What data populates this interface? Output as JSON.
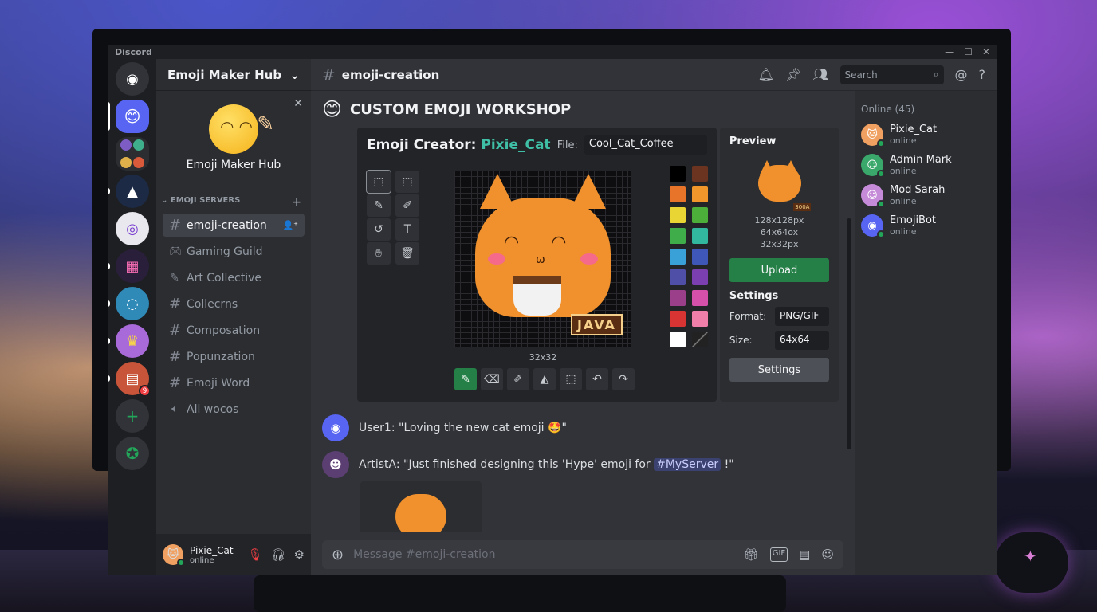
{
  "window": {
    "title": "Discord",
    "controls": [
      "—",
      "☐",
      "✕"
    ]
  },
  "server_rail": {
    "items": [
      {
        "name": "home",
        "icon": "discord-logo"
      },
      {
        "name": "emoji-maker-hub",
        "icon": "pencil-smiley",
        "active": true
      },
      {
        "name": "server-group"
      },
      {
        "name": "server-mountain"
      },
      {
        "name": "server-eye"
      },
      {
        "name": "server-pixel"
      },
      {
        "name": "server-ring"
      },
      {
        "name": "server-yellow"
      },
      {
        "name": "server-collage",
        "badge": "9"
      }
    ],
    "add_label": "+",
    "explore_icon": "compass-icon"
  },
  "sidebar": {
    "server_name": "Emoji Maker Hub",
    "banner_title": "Emoji Maker Hub",
    "category": "EMOJI SERVERS",
    "channels": [
      {
        "name": "emoji-creation",
        "icon": "#",
        "selected": true
      },
      {
        "name": "Gaming Guild",
        "icon": "gamepad"
      },
      {
        "name": "Art Collective",
        "icon": "pencil"
      },
      {
        "name": "Collecrns",
        "icon": "#"
      },
      {
        "name": "Composation",
        "icon": "#"
      },
      {
        "name": "Popunzation",
        "icon": "#"
      },
      {
        "name": "Emoji Word",
        "icon": "#"
      },
      {
        "name": "All wocos",
        "icon": "speaker"
      }
    ]
  },
  "user_bar": {
    "name": "Pixie_Cat",
    "status": "online"
  },
  "topbar": {
    "channel": "emoji-creation",
    "search_placeholder": "Search"
  },
  "workshop": {
    "title": "CUSTOM EMOJI WORKSHOP",
    "creator_label": "Emoji Creator:",
    "creator_user": "Pixie_Cat",
    "file_label": "File:",
    "file_value": "Cool_Cat_Coffee",
    "canvas_text": "JAVA",
    "canvas_size": "32x32",
    "palette": [
      "#000000",
      "#6b3420",
      "#e8742a",
      "#f0962a",
      "#e9d634",
      "#4caf3a",
      "#3fae4a",
      "#33b8a0",
      "#3aa0d8",
      "#3f57b8",
      "#4f4fa8",
      "#7b3fb0",
      "#9c3f8a",
      "#d64fa8",
      "#d83434",
      "#ef7ea8",
      "#ffffff",
      "#222222"
    ],
    "preview": {
      "title": "Preview",
      "tag": "300A",
      "sizes": [
        "128x128px",
        "64x64ox",
        "32x32px"
      ],
      "upload": "Upload"
    },
    "settings": {
      "title": "Settings",
      "format_label": "Format:",
      "format_value": "PNG/GIF",
      "size_label": "Size:",
      "size_value": "64x64",
      "button": "Settings"
    }
  },
  "messages": [
    {
      "author": "User1:",
      "text": "\"Loving the new cat emoji ",
      "emoji": "🤩",
      "tail": "\""
    },
    {
      "author": "ArtistA:",
      "text": "\"Just finished designing this 'Hype' emoji for ",
      "mention": "#MyServer",
      "tail": " !\""
    }
  ],
  "composer": {
    "placeholder": "Message #emoji-creation",
    "gif": "GIF"
  },
  "members": {
    "heading": "Online (45)",
    "list": [
      {
        "name": "Pixie_Cat",
        "status": "online",
        "color": "#f0a060"
      },
      {
        "name": "Admin Mark",
        "status": "online",
        "color": "#3aa86a"
      },
      {
        "name": "Mod Sarah",
        "status": "online",
        "color": "#c58ad8"
      },
      {
        "name": "EmojiBot",
        "status": "online",
        "color": "#5865f2"
      }
    ]
  }
}
